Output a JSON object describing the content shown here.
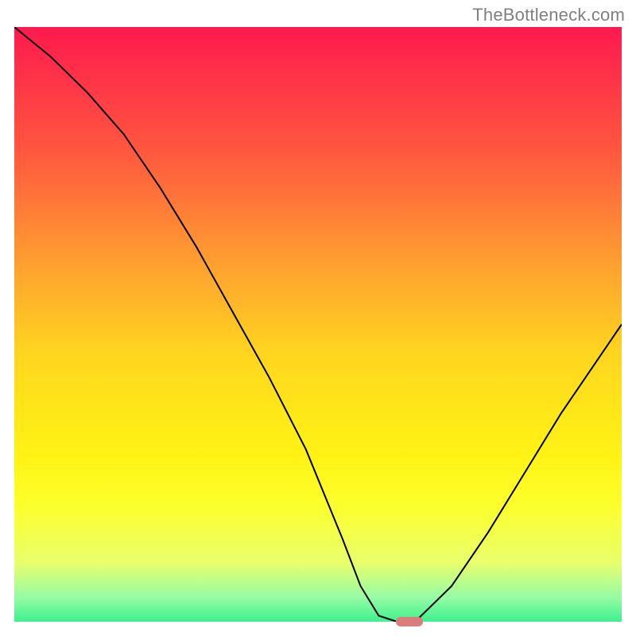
{
  "watermark": {
    "text": "TheBottleneck.com"
  },
  "chart_data": {
    "type": "line",
    "title": "",
    "xlabel": "",
    "ylabel": "",
    "xlim": [
      0,
      100
    ],
    "ylim": [
      0,
      100
    ],
    "grid": false,
    "legend": false,
    "background_gradient": {
      "direction": "vertical",
      "stops": [
        {
          "pos": 0.0,
          "color": "#ff1a4e"
        },
        {
          "pos": 0.2,
          "color": "#ff5440"
        },
        {
          "pos": 0.4,
          "color": "#ffa030"
        },
        {
          "pos": 0.55,
          "color": "#ffd61f"
        },
        {
          "pos": 0.72,
          "color": "#fff314"
        },
        {
          "pos": 0.8,
          "color": "#fdff2a"
        },
        {
          "pos": 0.9,
          "color": "#eaff6b"
        },
        {
          "pos": 0.96,
          "color": "#94fca5"
        },
        {
          "pos": 1.0,
          "color": "#3ef18d"
        }
      ]
    },
    "series": [
      {
        "name": "bottleneck-curve",
        "color": "#000000",
        "x": [
          0,
          6,
          12,
          18,
          24,
          30,
          36,
          42,
          48,
          54,
          57,
          60,
          63,
          66,
          72,
          78,
          84,
          90,
          96,
          100
        ],
        "y": [
          100,
          95,
          89,
          82,
          73,
          63,
          52,
          41,
          29,
          14,
          6,
          1,
          0,
          0,
          6,
          15,
          25,
          35,
          44,
          50
        ]
      }
    ],
    "marker": {
      "name": "optimal-point",
      "x": 65,
      "y": 0,
      "color": "#da7d7c"
    }
  }
}
